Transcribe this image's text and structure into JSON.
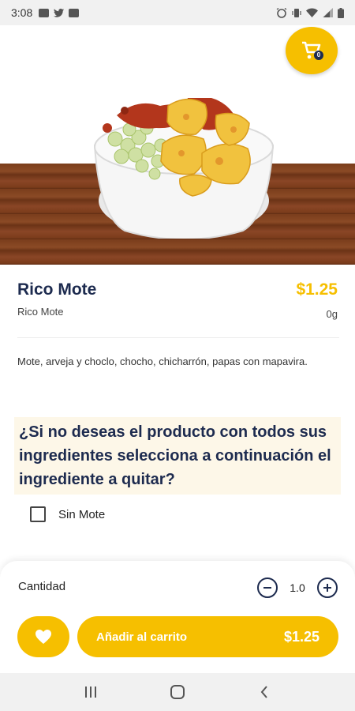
{
  "status_bar": {
    "time": "3:08"
  },
  "cart": {
    "count": "0"
  },
  "product": {
    "name": "Rico Mote",
    "price": "$1.25",
    "subtitle": "Rico Mote",
    "weight": "0g",
    "description": "Mote, arveja y choclo, chocho, chicharrón, papas con mapavira."
  },
  "ingredients": {
    "question": "¿Si no deseas el producto con todos sus ingredientes selecciona a continuación el ingrediente a quitar?",
    "options": [
      {
        "label": "Sin Mote",
        "checked": false
      }
    ]
  },
  "order": {
    "quantity_label": "Cantidad",
    "quantity": "1.0",
    "add_to_cart_label": "Añadir al carrito",
    "total": "$1.25"
  },
  "colors": {
    "accent": "#f6bf00",
    "navy": "#1d2b4f",
    "status_bar": "#f1f1f1"
  },
  "icons": {
    "cart": "shopping-cart-icon",
    "favorite": "heart-icon",
    "minus": "minus-circle-icon",
    "plus": "plus-circle-icon",
    "nav": [
      "recents-icon",
      "home-icon",
      "back-icon"
    ]
  }
}
